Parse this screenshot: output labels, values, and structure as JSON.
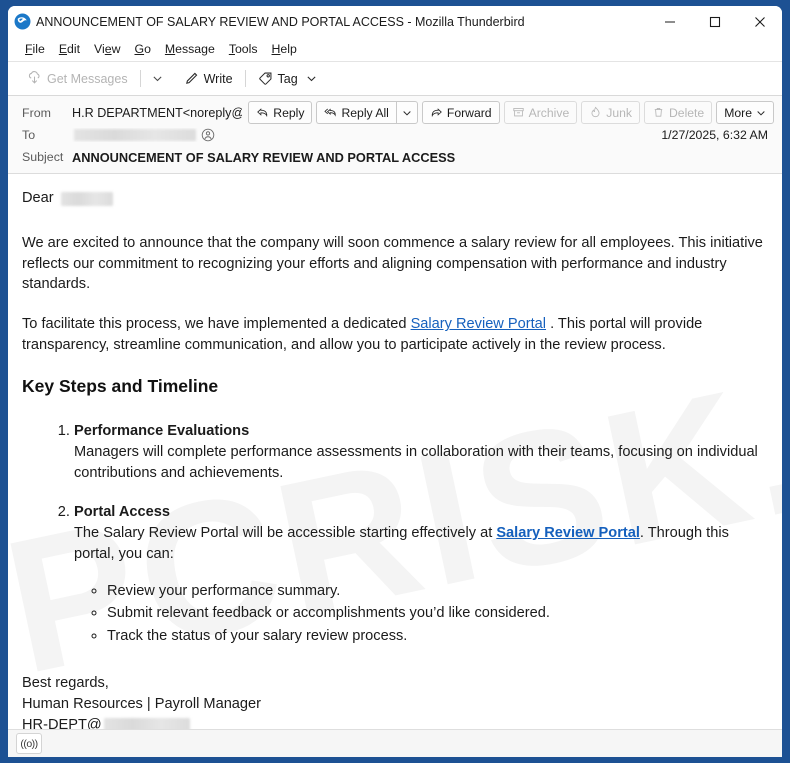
{
  "window": {
    "title": "ANNOUNCEMENT OF SALARY REVIEW AND PORTAL ACCESS - Mozilla Thunderbird",
    "logo_icon": "thunderbird-icon",
    "controls": {
      "minimize": "minimize-icon",
      "maximize": "maximize-icon",
      "close": "close-icon"
    },
    "border_color": "#1d5193"
  },
  "menubar": {
    "items": [
      {
        "label": "File",
        "accel": "F"
      },
      {
        "label": "Edit",
        "accel": "E"
      },
      {
        "label": "View",
        "accel": "V"
      },
      {
        "label": "Go",
        "accel": "G"
      },
      {
        "label": "Message",
        "accel": "M"
      },
      {
        "label": "Tools",
        "accel": "T"
      },
      {
        "label": "Help",
        "accel": "H"
      }
    ]
  },
  "toolbar": {
    "get_messages": "Get Messages",
    "get_messages_icon": "download-cloud-icon",
    "get_messages_chevron": "chevron-down-icon",
    "write": "Write",
    "write_icon": "pencil-icon",
    "tag": "Tag",
    "tag_icon": "tag-icon",
    "tag_chevron": "chevron-down-icon"
  },
  "header": {
    "from_label": "From",
    "from_name": "H.R DEPARTMENT",
    "from_open": "<noreply@",
    "from_close": ">",
    "from_domain_redacted": true,
    "to_label": "To",
    "to_redacted": true,
    "subject_label": "Subject",
    "subject": "ANNOUNCEMENT OF SALARY REVIEW AND PORTAL ACCESS",
    "date": "1/27/2025, 6:32 AM",
    "contact_icon": "contact-avatar-icon"
  },
  "actions": [
    {
      "label": "Reply",
      "icon": "reply-icon",
      "disabled": false,
      "has_arrow": false
    },
    {
      "label": "Reply All",
      "icon": "reply-all-icon",
      "disabled": false,
      "has_arrow": true
    },
    {
      "label": "Forward",
      "icon": "forward-icon",
      "disabled": false,
      "has_arrow": false
    },
    {
      "label": "Archive",
      "icon": "archive-box-icon",
      "disabled": true,
      "has_arrow": false
    },
    {
      "label": "Junk",
      "icon": "junk-flame-icon",
      "disabled": true,
      "has_arrow": false
    },
    {
      "label": "Delete",
      "icon": "trash-icon",
      "disabled": true,
      "has_arrow": false
    },
    {
      "label": "More",
      "icon": "chevron-down-icon",
      "disabled": false,
      "has_arrow": true
    }
  ],
  "message": {
    "watermark_text": "PCRISK.COM",
    "salutation": "Dear",
    "salutation_name_redacted": true,
    "para1": "We are excited to announce that the company will soon commence a salary review for all employees. This initiative reflects our commitment to recognizing your efforts and aligning compensation with performance and industry standards.",
    "para2_before": "To facilitate this process, we have implemented a dedicated ",
    "para2_link": "Salary Review Portal",
    "para2_after": " . This portal will provide transparency, streamline communication, and allow you to participate actively in the review process.",
    "heading": "Key Steps and Timeline",
    "steps": [
      {
        "title": "Performance Evaluations",
        "text": "Managers will complete performance assessments in collaboration with their teams, focusing on individual contributions and achievements."
      },
      {
        "title": "Portal Access",
        "text_before": "The Salary Review Portal will be accessible starting effectively at ",
        "link": "Salary Review Portal",
        "text_after": ". Through this portal, you can:",
        "sub_items": [
          "Review your performance summary.",
          "Submit relevant feedback or accomplishments you’d like considered.",
          "Track the status of your salary review process."
        ]
      }
    ],
    "signature": {
      "line1": "Best regards,",
      "line2": "Human Resources | Payroll Manager",
      "line3_prefix": "HR-DEPT@",
      "line3_redacted": true
    },
    "link_color": "#1560bd"
  },
  "statusbar": {
    "online_icon": "((o))"
  }
}
